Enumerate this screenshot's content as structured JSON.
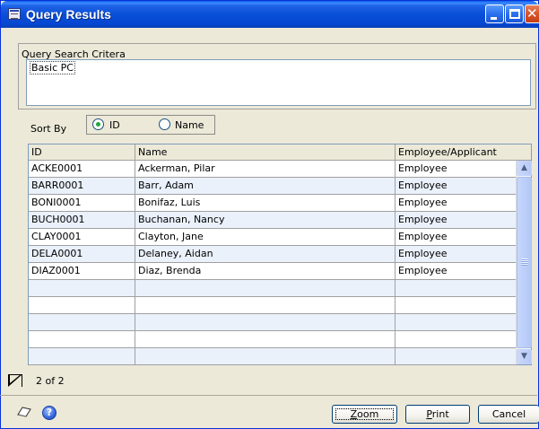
{
  "window": {
    "title": "Query Results"
  },
  "criteria": {
    "label": "Query Search Critera",
    "value": "Basic PC"
  },
  "sort": {
    "label": "Sort By",
    "options": [
      "ID",
      "Name"
    ],
    "selected": "ID"
  },
  "table": {
    "headers": [
      "ID",
      "Name",
      "Employee/Applicant"
    ],
    "rows": [
      {
        "id": "ACKE0001",
        "name": "Ackerman, Pilar",
        "type": "Employee"
      },
      {
        "id": "BARR0001",
        "name": "Barr, Adam",
        "type": "Employee"
      },
      {
        "id": "BONI0001",
        "name": "Bonifaz, Luis",
        "type": "Employee"
      },
      {
        "id": "BUCH0001",
        "name": "Buchanan, Nancy",
        "type": "Employee"
      },
      {
        "id": "CLAY0001",
        "name": "Clayton, Jane",
        "type": "Employee"
      },
      {
        "id": "DELA0001",
        "name": "Delaney, Aidan",
        "type": "Employee"
      },
      {
        "id": "DIAZ0001",
        "name": "Diaz, Brenda",
        "type": "Employee"
      },
      {
        "id": "",
        "name": "",
        "type": ""
      },
      {
        "id": "",
        "name": "",
        "type": ""
      },
      {
        "id": "",
        "name": "",
        "type": ""
      },
      {
        "id": "",
        "name": "",
        "type": ""
      },
      {
        "id": "",
        "name": "",
        "type": ""
      }
    ]
  },
  "record": {
    "text": "2 of 2"
  },
  "buttons": {
    "zoom_mnemonic": "Z",
    "zoom_rest": "oom",
    "print_mnemonic": "P",
    "print_rest": "rint",
    "cancel": "Cancel"
  },
  "icons": {
    "window": "window-icon",
    "minimize": "minimize-icon",
    "maximize": "maximize-icon",
    "close": "close-icon",
    "note": "note-icon",
    "help": "help-icon",
    "scroll_up": "chevron-up-icon",
    "scroll_down": "chevron-down-icon"
  },
  "colors": {
    "titlebar": "#0a4fd8",
    "close_button": "#d9532b",
    "alt_row": "#eaf1fb",
    "radio_dot": "#20a83a"
  }
}
